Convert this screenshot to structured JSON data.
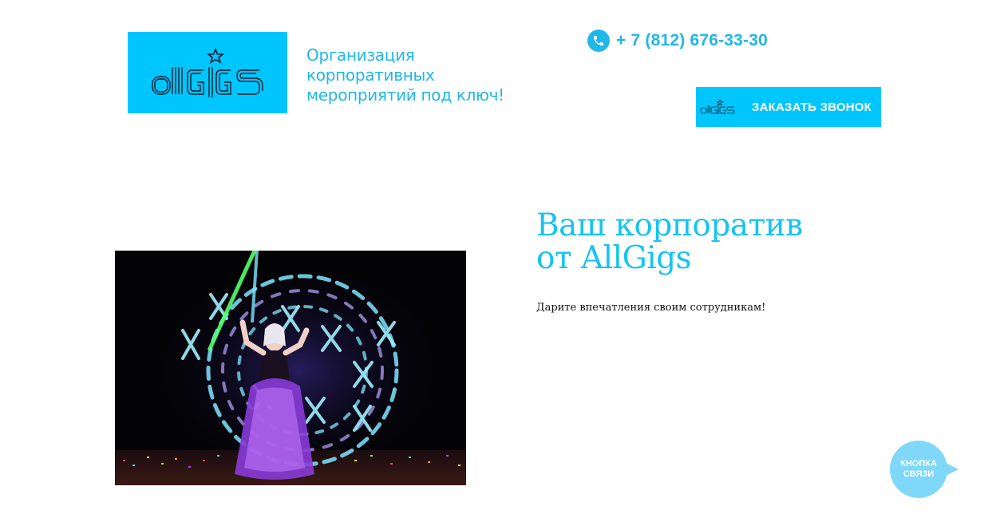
{
  "header": {
    "logo_alt": "allGIGS",
    "tagline": "Организация корпоративных мероприятий под ключ!",
    "phone": "+ 7 (812) 676-33-30",
    "callback_label": "ЗАКАЗАТЬ ЗВОНОК"
  },
  "hero": {
    "title_line1": "Ваш корпоратив",
    "title_line2": "от AllGigs",
    "subtitle": "Дарите впечатления своим сотрудникам!"
  },
  "contact_widget": {
    "line1": "КНОПКА",
    "line2": "СВЯЗИ"
  },
  "colors": {
    "brand_cyan": "#00c6ff",
    "text_cyan": "#1fb8e8",
    "bubble": "#7fd8f7"
  },
  "icons": {
    "phone": "phone-icon",
    "logo_star": "star-icon"
  }
}
